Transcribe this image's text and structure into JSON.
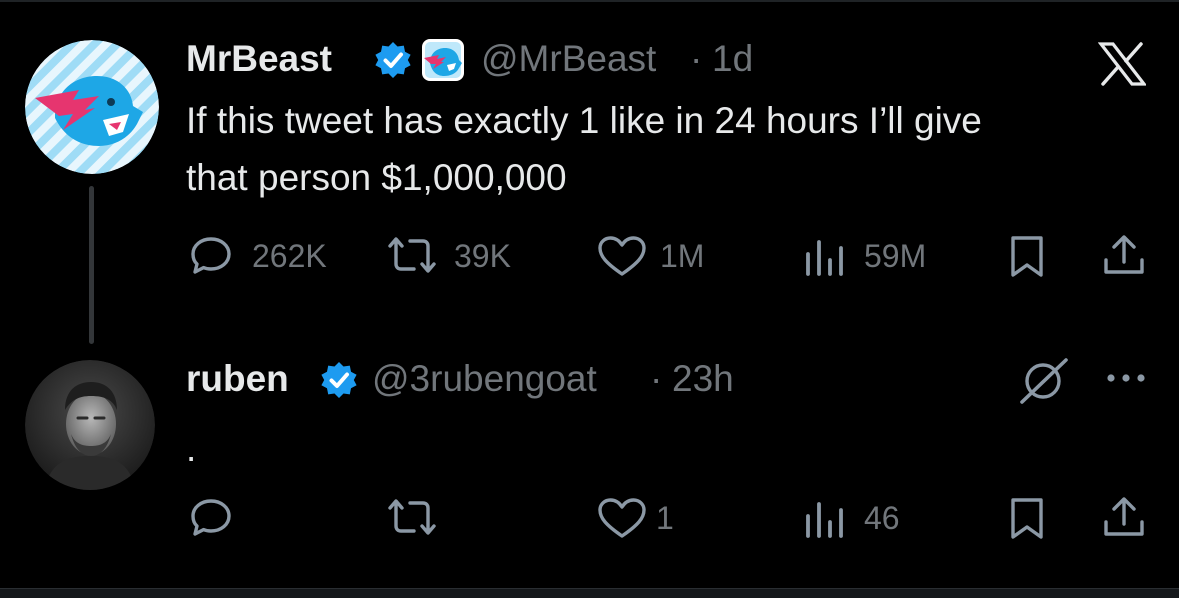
{
  "colors": {
    "background": "#000000",
    "text": "#e7e9ea",
    "muted": "#71767b",
    "verified": "#1d9bf0"
  },
  "tweet": {
    "author": {
      "name": "MrBeast",
      "handle": "@MrBeast",
      "time": "1d",
      "badges": [
        "verified-badge-icon",
        "affiliate-logo-icon"
      ]
    },
    "text_line1": "If this tweet has exactly 1 like in 24 hours I’ll give",
    "text_line2": "that person $1,000,000",
    "platform_icon": "x-logo-icon",
    "stats": {
      "replies": "262K",
      "reposts": "39K",
      "likes": "1M",
      "views": "59M"
    }
  },
  "reply": {
    "author": {
      "name": "ruben",
      "handle": "@3rubengoat",
      "time": "23h",
      "badges": [
        "verified-badge-icon"
      ]
    },
    "text": ".",
    "stats": {
      "replies": "",
      "reposts": "",
      "likes": "1",
      "views": "46"
    },
    "actions": [
      "grok-icon",
      "more-icon"
    ]
  },
  "separator": "·"
}
